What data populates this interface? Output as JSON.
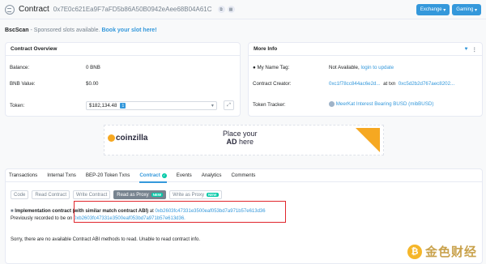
{
  "header": {
    "title": "Contract",
    "address": "0x7E0c621Ea9F7aFD5b86A50B0942eAee68B04A61C",
    "buttons": {
      "exchange": "Exchange",
      "gaming": "Gaming"
    }
  },
  "sponsor": {
    "brand": "BscScan",
    "text": " - Sponsored slots available.",
    "link": "Book your slot here!"
  },
  "overview": {
    "title": "Contract Overview",
    "balance_label": "Balance:",
    "balance_value": "0 BNB",
    "bnb_value_label": "BNB Value:",
    "bnb_value": "$0.00",
    "token_label": "Token:",
    "token_value": "$182,134.48",
    "token_count": "1"
  },
  "more_info": {
    "title": "More Info",
    "name_tag_label": "My Name Tag:",
    "name_tag_value": "Not Available,",
    "name_tag_link": "login to update",
    "creator_label": "Contract Creator:",
    "creator_addr": "0xc1f78cc844ac6e2d...",
    "creator_at": "at txn",
    "creator_txn": "0xc5d2b2d767aec8202...",
    "tracker_label": "Token Tracker:",
    "tracker_value": "MeerKat Interest Bearing BUSD (mibBUSD)"
  },
  "ad": {
    "brand": "coinzilla",
    "line1": "Place your",
    "line2a": "AD",
    "line2b": " here"
  },
  "tabs": {
    "items": [
      "Transactions",
      "Internal Txns",
      "BEP-20 Token Txns",
      "Contract",
      "Events",
      "Analytics",
      "Comments"
    ],
    "sub": [
      "Code",
      "Read Contract",
      "Write Contract",
      "Read as Proxy",
      "Write as Proxy"
    ],
    "new_badge": "NEW"
  },
  "proxy": {
    "impl_label": "Implementation contract",
    "impl_note": " (with similar match contract ABI)",
    "impl_at": " at ",
    "impl_addr": "0xb2603fc47331e3500eaf053bd7a971b57e613d36",
    "prev_label": "Previously recorded to be on ",
    "prev_addr": "0xb2603fc47331e3500eaf053bd7a971b57e613d36.",
    "sorry": "Sorry, there are no available Contract ABI methods to read. Unable to read contract info."
  },
  "watermark": {
    "text": "金色财经"
  }
}
